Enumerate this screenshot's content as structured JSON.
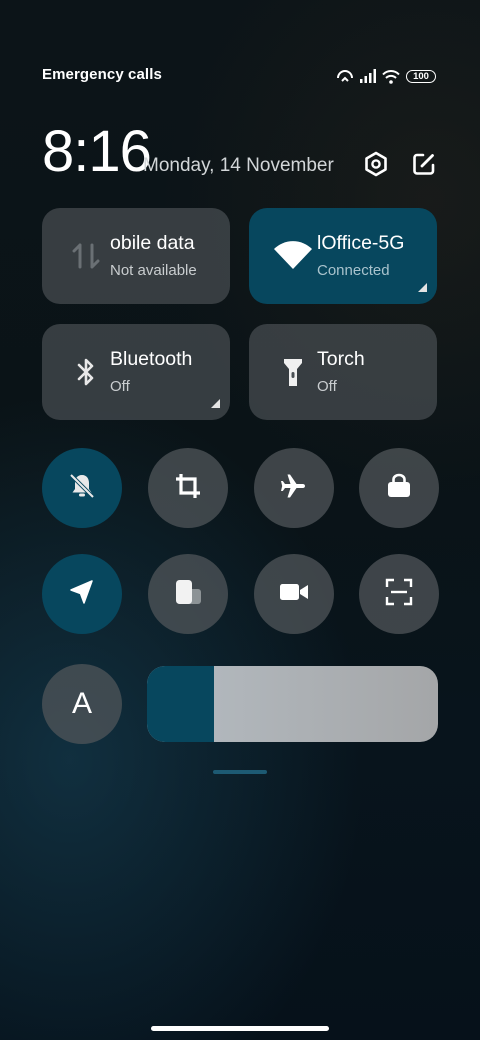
{
  "status_bar": {
    "text": "Emergency calls o",
    "battery": "100",
    "icons": [
      "hotspot-icon",
      "signal-icon",
      "wifi-icon",
      "battery-icon"
    ]
  },
  "header": {
    "time": "8:16",
    "date": "Monday, 14 November",
    "icons": [
      "settings-icon",
      "edit-icon"
    ]
  },
  "tiles": [
    {
      "title": "obile data",
      "subtitle": "Not available",
      "active": false,
      "icon": "mobile-data-icon"
    },
    {
      "title": "lOffice-5G",
      "subtitle": "Connected",
      "active": true,
      "icon": "wifi-icon"
    },
    {
      "title": "Bluetooth",
      "subtitle": "Off",
      "active": false,
      "icon": "bluetooth-icon"
    },
    {
      "title": "Torch",
      "subtitle": "Off",
      "active": false,
      "icon": "torch-icon"
    }
  ],
  "toggles": [
    {
      "icon": "bell-off-icon",
      "active": true
    },
    {
      "icon": "crop-icon",
      "active": false
    },
    {
      "icon": "airplane-icon",
      "active": false
    },
    {
      "icon": "lock-icon",
      "active": false
    },
    {
      "icon": "location-icon",
      "active": true
    },
    {
      "icon": "rotate-icon",
      "active": false
    },
    {
      "icon": "video-camera-icon",
      "active": false
    },
    {
      "icon": "scan-icon",
      "active": false
    }
  ],
  "brightness": {
    "auto_label": "A",
    "level": 0.23
  },
  "colors": {
    "accent": "#07475e",
    "tile_gray": "#484e52",
    "background": "#0a1317"
  }
}
